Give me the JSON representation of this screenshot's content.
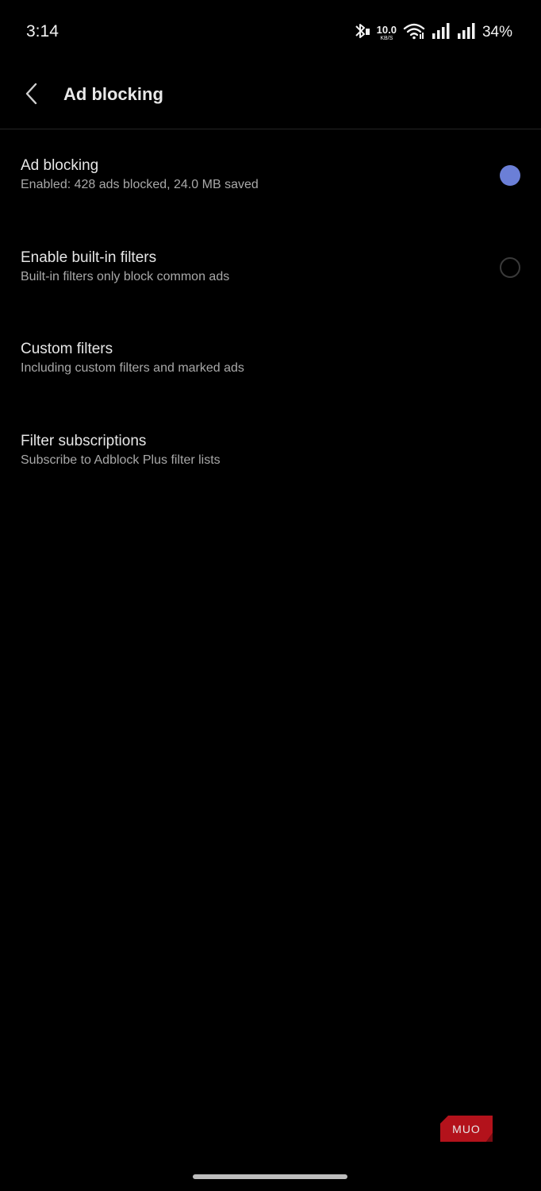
{
  "status_bar": {
    "time": "3:14",
    "net_speed_value": "10.0",
    "net_speed_unit": "KB/S",
    "battery": "34%",
    "icons": [
      "bluetooth-icon",
      "wifi-icon",
      "signal-icon",
      "signal-icon"
    ]
  },
  "app_bar": {
    "back_icon": "chevron-left-icon",
    "title": "Ad blocking"
  },
  "settings": [
    {
      "title": "Ad blocking",
      "subtitle": "Enabled: 428 ads blocked, 24.0 MB saved",
      "toggle": "on"
    },
    {
      "title": "Enable built-in filters",
      "subtitle": "Built-in filters only block common ads",
      "toggle": "off"
    },
    {
      "title": "Custom filters",
      "subtitle": "Including custom filters and marked ads"
    },
    {
      "title": "Filter subscriptions",
      "subtitle": "Subscribe to Adblock Plus filter lists"
    }
  ],
  "watermark": {
    "text": "MUO"
  },
  "colors": {
    "background": "#000000",
    "accent": "#6b7fd7",
    "title_text": "#e6e6e6",
    "subtitle_text": "#a8a8a8",
    "watermark": "#b3121b"
  }
}
